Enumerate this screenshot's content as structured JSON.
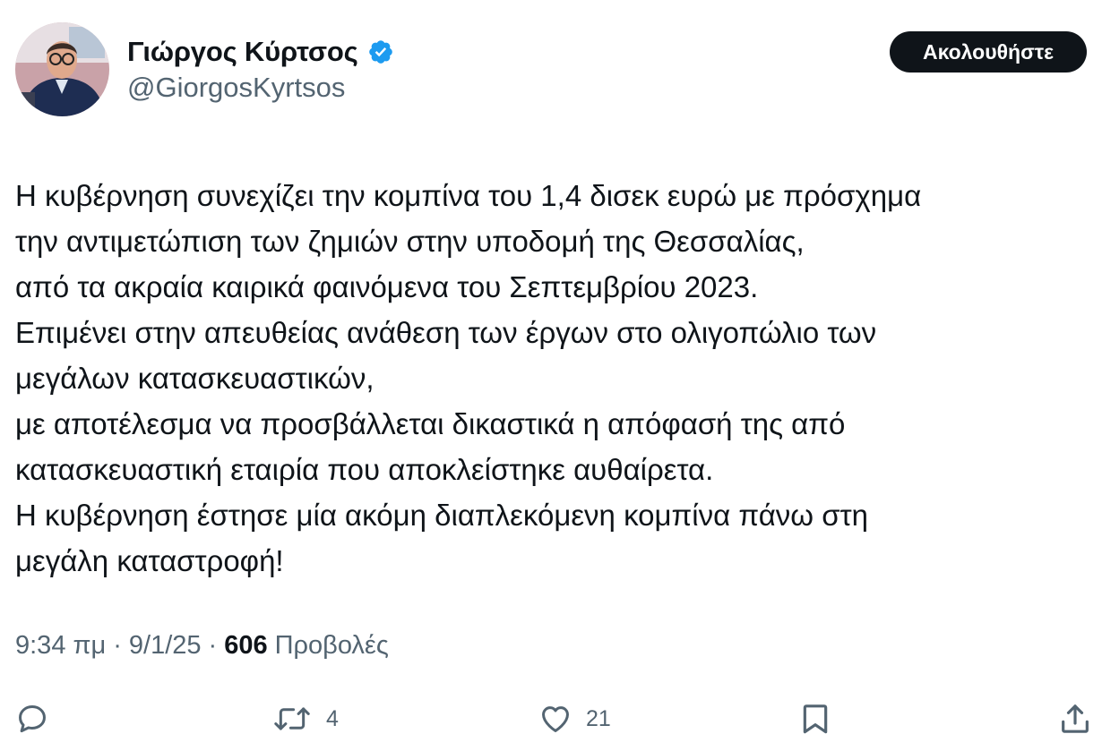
{
  "author": {
    "display_name": "Γιώργος Κύρτσος",
    "handle": "@GiorgosKyrtsos",
    "verified": true,
    "avatar": "profile-photo"
  },
  "follow_button": {
    "label": "Ακολουθήστε"
  },
  "tweet": {
    "lines": [
      "Η κυβέρνηση συνεχίζει την κομπίνα του 1,4 δισεκ ευρώ με πρόσχημα",
      "την αντιμετώπιση των ζημιών στην υποδομή της Θεσσαλίας,",
      "από τα ακραία καιρικά φαινόμενα του Σεπτεμβρίου 2023.",
      "Επιμένει στην απευθείας ανάθεση των έργων στο ολιγοπώλιο των",
      "μεγάλων κατασκευαστικών,",
      "με αποτέλεσμα να προσβάλλεται δικαστικά η απόφασή της από",
      "κατασκευαστική εταιρία που αποκλείστηκε αυθαίρετα.",
      "Η κυβέρνηση έστησε μία ακόμη διαπλεκόμενη κομπίνα πάνω στη",
      "μεγάλη καταστροφή!"
    ]
  },
  "meta": {
    "time": "9:34 πμ",
    "separator": "·",
    "date": "9/1/25",
    "views_count": "606",
    "views_label": "Προβολές"
  },
  "actions": {
    "reply": {
      "icon": "reply-icon",
      "count": ""
    },
    "retweet": {
      "icon": "retweet-icon",
      "count": "4"
    },
    "like": {
      "icon": "heart-icon",
      "count": "21"
    },
    "bookmark": {
      "icon": "bookmark-icon",
      "count": ""
    },
    "share": {
      "icon": "share-icon",
      "count": ""
    }
  },
  "colors": {
    "text": "#0f1419",
    "secondary": "#536471",
    "verified": "#1d9bf0",
    "button_bg": "#0f1419"
  }
}
